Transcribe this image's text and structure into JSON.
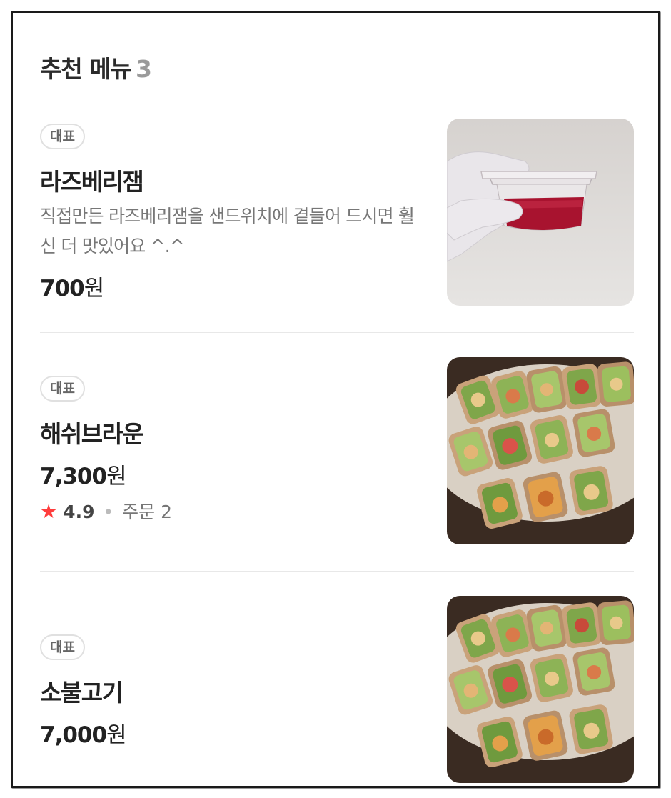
{
  "section": {
    "title": "추천 메뉴",
    "count": "3"
  },
  "items": [
    {
      "badge": "대표",
      "name": "라즈베리잼",
      "description": "직접만든 라즈베리잼을 샌드위치에 곁들어 드시면 훨신 더 맛있어요 ^.^",
      "price_number": "700",
      "price_unit": "원",
      "image": "raspberry-jam-cup-photo"
    },
    {
      "badge": "대표",
      "name": "해쉬브라운",
      "price_number": "7,300",
      "price_unit": "원",
      "rating_star": "★",
      "rating": "4.9",
      "rating_sep": "•",
      "orders": "주문 2",
      "image": "sandwich-platter-photo"
    },
    {
      "badge": "대표",
      "name": "소불고기",
      "price_number": "7,000",
      "price_unit": "원",
      "image": "sandwich-platter-photo"
    }
  ]
}
